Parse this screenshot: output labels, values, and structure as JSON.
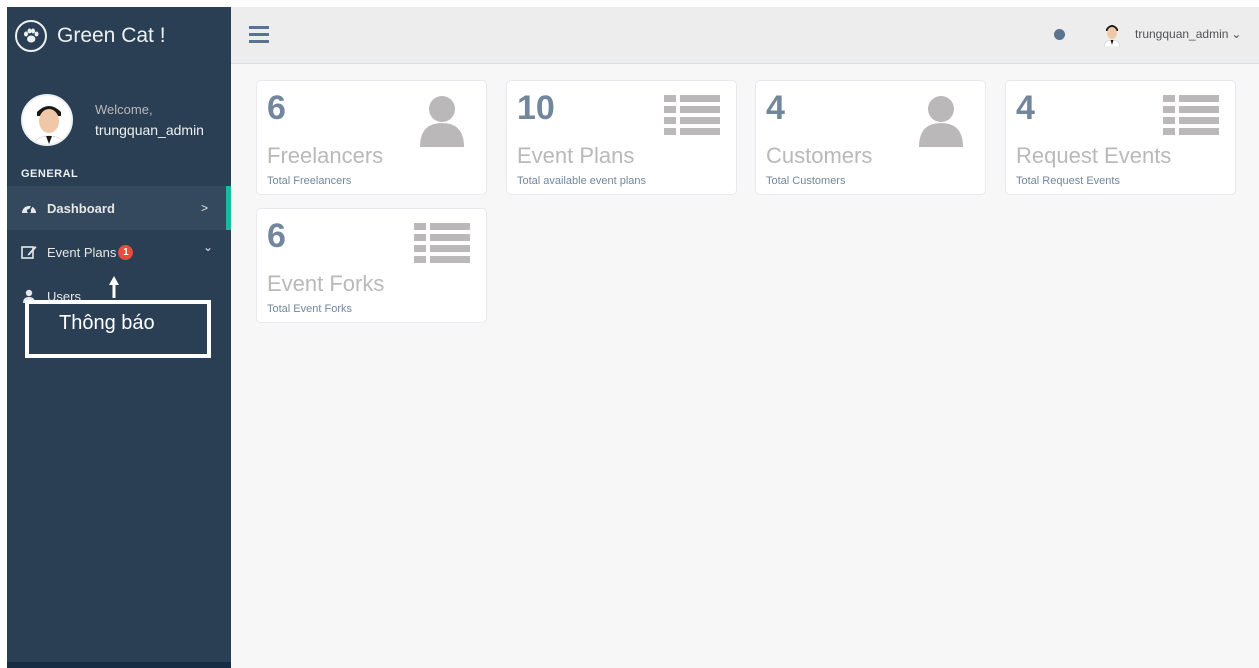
{
  "brand": {
    "name": "Green Cat !",
    "logo_icon": "paw-icon"
  },
  "profile": {
    "welcome": "Welcome,",
    "username": "trungquan_admin"
  },
  "sidebar": {
    "section_title": "GENERAL",
    "items": [
      {
        "label": "Dashboard",
        "icon": "dashboard-icon",
        "chevron": ">"
      },
      {
        "label": "Event Plans",
        "icon": "edit-icon",
        "badge": "1",
        "chevron": "⌄"
      },
      {
        "label": "Users",
        "icon": "user-icon"
      }
    ]
  },
  "annotation": {
    "text": "Thông báo"
  },
  "topbar": {
    "username": "trungquan_admin",
    "caret": "⌄"
  },
  "tiles": [
    {
      "count": "6",
      "title": "Freelancers",
      "subtitle": "Total Freelancers",
      "icon": "user-icon"
    },
    {
      "count": "10",
      "title": "Event Plans",
      "subtitle": "Total available event plans",
      "icon": "list-icon"
    },
    {
      "count": "4",
      "title": "Customers",
      "subtitle": "Total Customers",
      "icon": "user-icon"
    },
    {
      "count": "4",
      "title": "Request Events",
      "subtitle": "Total Request Events",
      "icon": "list-icon"
    },
    {
      "count": "6",
      "title": "Event Forks",
      "subtitle": "Total Event Forks",
      "icon": "list-icon"
    }
  ],
  "colors": {
    "sidebar": "#2a3f54",
    "accent": "#1abb9c",
    "badge": "#e74c3c",
    "text_muted": "#73879c",
    "icon_gray": "#bab8b8"
  }
}
